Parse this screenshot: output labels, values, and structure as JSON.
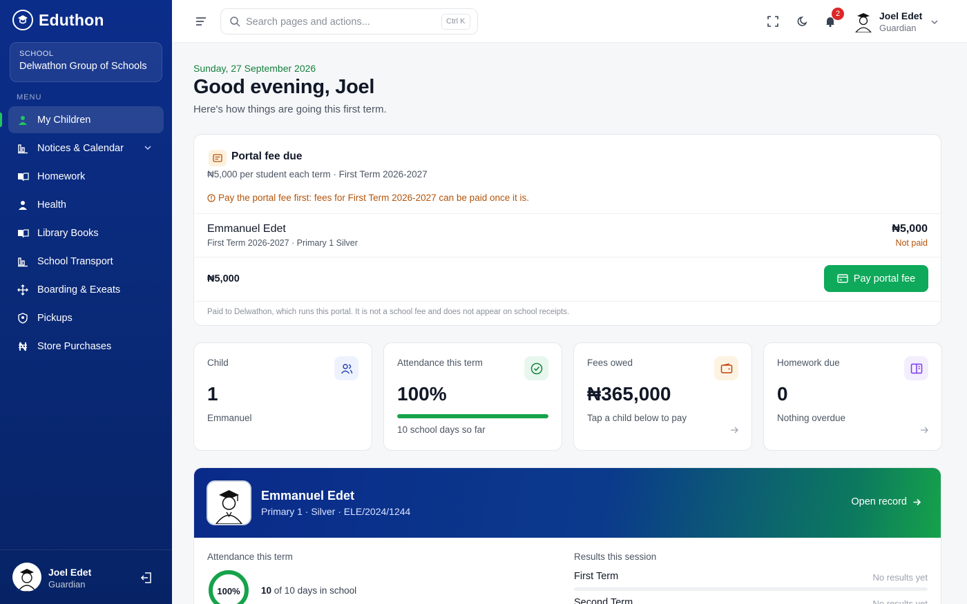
{
  "brand": {
    "name": "Eduthon",
    "logo_icon": "school-logo-icon"
  },
  "school": {
    "caption": "SCHOOL",
    "name": "Delwathon Group of Schools"
  },
  "menu": {
    "caption": "MENU",
    "items": [
      {
        "label": "My Children",
        "icon": "user-icon",
        "active": true
      },
      {
        "label": "Notices & Calendar",
        "icon": "chart-icon",
        "expandable": true
      },
      {
        "label": "Homework",
        "icon": "book-open-icon"
      },
      {
        "label": "Health",
        "icon": "user-badge-icon"
      },
      {
        "label": "Library Books",
        "icon": "book-open-icon"
      },
      {
        "label": "School Transport",
        "icon": "chart-icon"
      },
      {
        "label": "Boarding & Exeats",
        "icon": "move-icon"
      },
      {
        "label": "Pickups",
        "icon": "shield-user-icon"
      },
      {
        "label": "Store Purchases",
        "icon": "naira-icon"
      }
    ]
  },
  "sidebar_footer": {
    "name": "Joel Edet",
    "role": "Guardian"
  },
  "topbar": {
    "search_placeholder": "Search pages and actions...",
    "shortcut": "Ctrl K",
    "notification_count": "2",
    "user_name": "Joel Edet",
    "user_role": "Guardian"
  },
  "header": {
    "date": "Sunday, 27 September 2026",
    "greeting": "Good evening, Joel",
    "subtitle": "Here's how things are going this first term."
  },
  "portal_fee": {
    "title": "Portal fee due",
    "subtitle": "₦5,000 per student each term · First Term 2026-2027",
    "warning": "Pay the portal fee first: fees for First Term 2026-2027 can be paid once it is.",
    "student_name": "Emmanuel Edet",
    "student_meta": "First Term 2026-2027 · Primary 1 Silver",
    "amount": "₦5,000",
    "status": "Not paid",
    "total": "₦5,000",
    "pay_button": "Pay portal fee",
    "note": "Paid to Delwathon, which runs this portal. It is not a school fee and does not appear on school receipts."
  },
  "stats": [
    {
      "label": "Child",
      "value": "1",
      "sub": "Emmanuel",
      "icon": "users-icon"
    },
    {
      "label": "Attendance this term",
      "value": "100%",
      "sub": "10 school days so far",
      "icon": "check-circle-icon",
      "progress": 100
    },
    {
      "label": "Fees owed",
      "value": "₦365,000",
      "sub": "Tap a child below to pay",
      "icon": "wallet-icon"
    },
    {
      "label": "Homework due",
      "value": "0",
      "sub": "Nothing overdue",
      "icon": "book-icon"
    }
  ],
  "child": {
    "name": "Emmanuel Edet",
    "meta": "Primary 1 · Silver · ELE/2024/1244",
    "open_record": "Open record",
    "attendance_title": "Attendance this term",
    "attendance_percent": "100%",
    "attendance_fraction": 1,
    "attendance_days_present": "10",
    "attendance_days_text": "of 10 days in school",
    "results_title": "Results this session",
    "results": [
      {
        "term": "First Term",
        "status": "No results yet"
      },
      {
        "term": "Second Term",
        "status": "No results yet"
      }
    ]
  },
  "colors": {
    "sidebar": "#0b2d8a",
    "accent": "#0ea95a",
    "warning": "#b45309",
    "badge": "#dc2626"
  }
}
